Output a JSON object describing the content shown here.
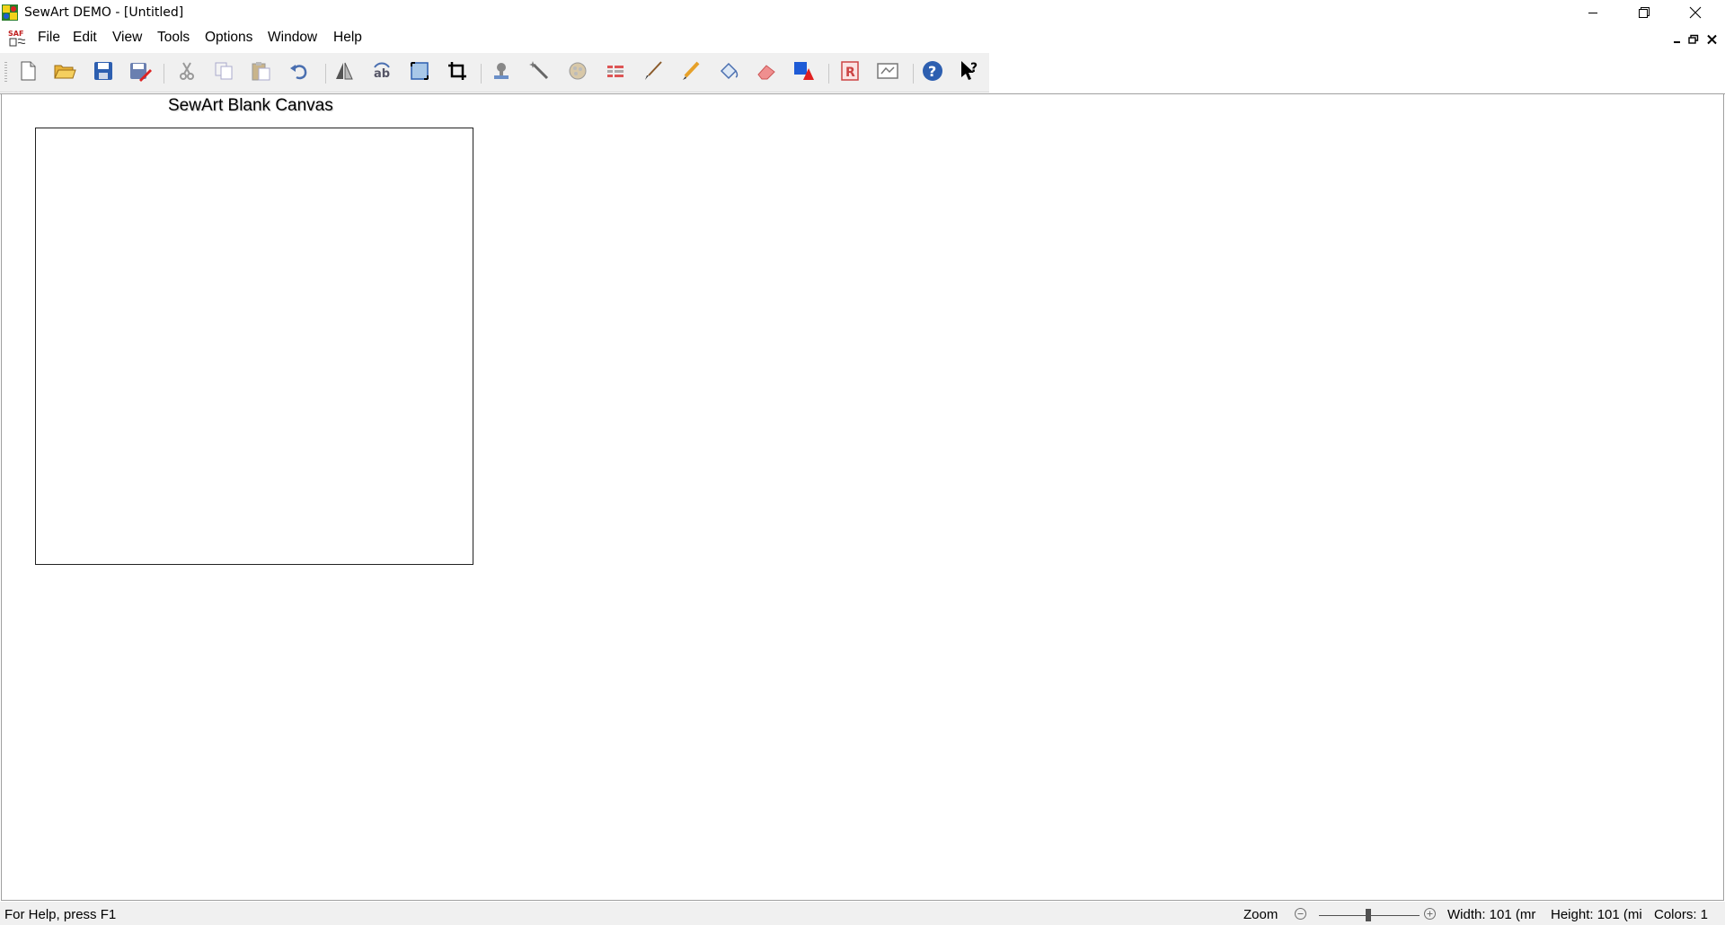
{
  "window": {
    "title": "SewArt DEMO - [Untitled]",
    "app_icon": "sewart-app-icon",
    "controls": [
      "minimize-icon",
      "restore-icon",
      "close-icon"
    ]
  },
  "menu": {
    "items": [
      {
        "label": "File"
      },
      {
        "label": "Edit"
      },
      {
        "label": "View"
      },
      {
        "label": "Tools"
      },
      {
        "label": "Options"
      },
      {
        "label": "Window"
      },
      {
        "label": "Help"
      }
    ],
    "doc_icon": "sewart-document-icon",
    "mdi_controls": [
      "mdi-minimize-icon",
      "mdi-restore-icon",
      "mdi-close-icon"
    ]
  },
  "toolbar": {
    "buttons": [
      "new-icon",
      "open-icon",
      "save-icon",
      "save-as-icon",
      "cut-icon",
      "copy-icon",
      "paste-icon",
      "undo-icon",
      "mirror-icon",
      "rotate-icon",
      "canvas-size-icon",
      "crop-icon",
      "stamp-icon",
      "wand-icon",
      "color-merge-icon",
      "separate-icon",
      "brush-icon",
      "pencil-icon",
      "fill-icon",
      "eraser-icon",
      "color-replace-icon",
      "remove-background-icon",
      "transform-icon",
      "help-icon",
      "context-help-icon"
    ]
  },
  "canvas": {
    "label": "SewArt Blank Canvas"
  },
  "status": {
    "help_text": "For Help, press F1",
    "zoom_label": "Zoom",
    "width": "Width: 101 (mr",
    "height": "Height: 101 (mi",
    "colors": "Colors: 1"
  },
  "colors": {
    "accent_blue": "#1e5bd6",
    "toolbar_bg": "#f0f0f0"
  }
}
